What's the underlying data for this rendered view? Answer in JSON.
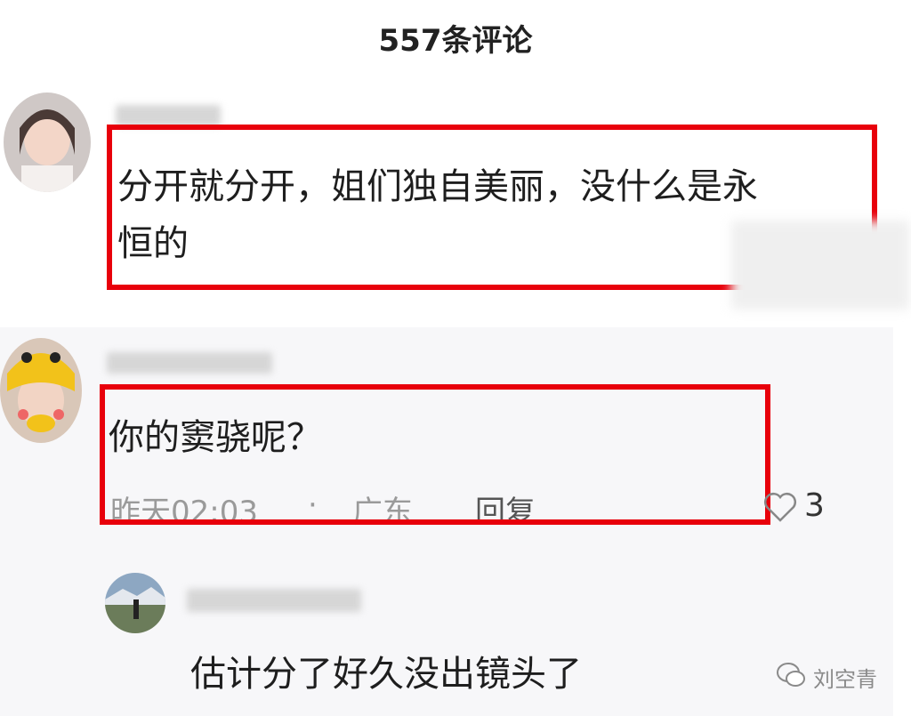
{
  "header": {
    "title": "557条评论"
  },
  "comments": [
    {
      "text_line1": "分开就分开，姐们独自美丽，没什么是永",
      "text_line2": "恒的"
    },
    {
      "text": "你的窦骁呢？",
      "time": "昨天02:03",
      "separator": "·",
      "location": "广东",
      "reply_label": "回复",
      "likes": "3"
    },
    {
      "text": "估计分了好久没出镜头了"
    }
  ],
  "watermark": {
    "label": "刘空青"
  },
  "colors": {
    "highlight": "#e8000b",
    "reply_bg": "#f7f7f9"
  }
}
